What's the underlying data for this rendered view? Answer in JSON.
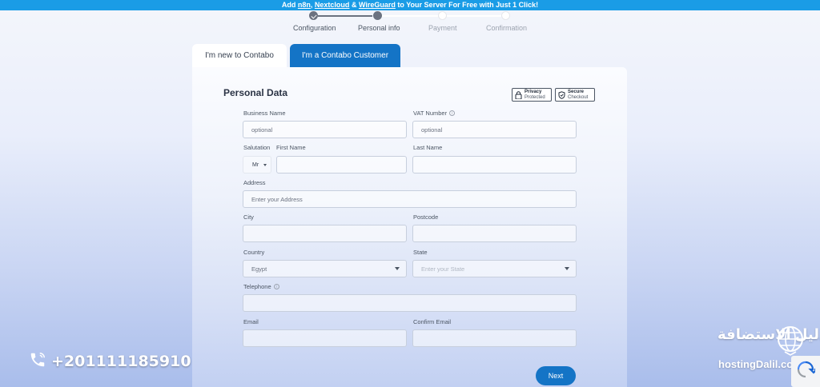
{
  "promo": {
    "pre": "Add ",
    "link1": "n8n",
    "sep1": ", ",
    "link2": "Nextcloud",
    "sep2": " & ",
    "link3": "WireGuard",
    "post": " to Your Server For Free with Just 1 Click!"
  },
  "steps": [
    {
      "label": "Configuration",
      "state": "done"
    },
    {
      "label": "Personal info",
      "state": "current"
    },
    {
      "label": "Payment",
      "state": "upcoming"
    },
    {
      "label": "Confirmation",
      "state": "upcoming"
    }
  ],
  "tabs": {
    "new": "I'm new to Contabo",
    "customer": "I'm a Contabo Customer"
  },
  "form": {
    "title": "Personal Data",
    "badges": {
      "privacy": {
        "line1": "Privacy",
        "line2": "Protected",
        "icon": "lock-icon"
      },
      "secure": {
        "line1": "Secure",
        "line2": "Checkout",
        "icon": "shield-icon"
      }
    },
    "business_name": {
      "label": "Business Name",
      "placeholder": "optional"
    },
    "vat_number": {
      "label": "VAT Number",
      "placeholder": "optional"
    },
    "salutation": {
      "label": "Salutation",
      "value": "Mr"
    },
    "first_name": {
      "label": "First Name",
      "value": ""
    },
    "last_name": {
      "label": "Last Name",
      "value": ""
    },
    "address": {
      "label": "Address",
      "placeholder": "Enter your Address"
    },
    "city": {
      "label": "City",
      "value": ""
    },
    "postcode": {
      "label": "Postcode",
      "value": ""
    },
    "country": {
      "label": "Country",
      "value": "Egypt"
    },
    "state": {
      "label": "State",
      "placeholder": "Enter your State"
    },
    "telephone": {
      "label": "Telephone",
      "value": ""
    },
    "email": {
      "label": "Email",
      "value": ""
    },
    "confirm_email": {
      "label": "Confirm Email",
      "value": ""
    },
    "next_label": "Next"
  },
  "watermark": {
    "phone": "+201111185910",
    "logo_arabic": "دليل الاستضافة",
    "logo_latin": "hostingDalil.com"
  },
  "colors": {
    "primary": "#1474c6",
    "promo_bar": "#1a9ce6"
  }
}
